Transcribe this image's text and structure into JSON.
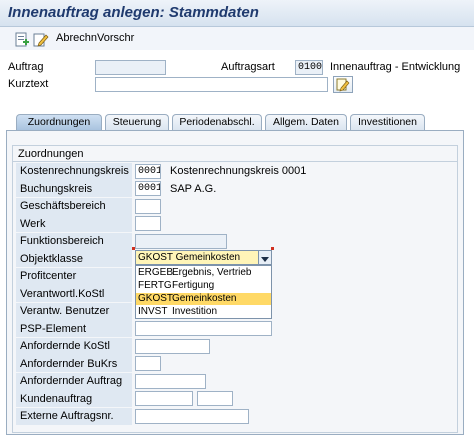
{
  "title": "Innenauftrag anlegen: Stammdaten",
  "toolbar": {
    "text": "AbrechnVorschr",
    "icons": [
      "create-icon",
      "edit-icon"
    ]
  },
  "header": {
    "auftrag_label": "Auftrag",
    "auftrag_value": "",
    "auftragsart_label": "Auftragsart",
    "auftragsart_value": "0100",
    "auftragsart_text": "Innenauftrag - Entwicklung",
    "kurztext_label": "Kurztext",
    "kurztext_value": ""
  },
  "tabs": [
    {
      "label": "Zuordnungen",
      "active": true
    },
    {
      "label": "Steuerung",
      "active": false
    },
    {
      "label": "Periodenabschl.",
      "active": false
    },
    {
      "label": "Allgem. Daten",
      "active": false
    },
    {
      "label": "Investitionen",
      "active": false
    }
  ],
  "group_title": "Zuordnungen",
  "fields": {
    "kostenrechnungskreis": {
      "label": "Kostenrechnungskreis",
      "value": "0001",
      "text": "Kostenrechnungskreis 0001"
    },
    "buchungskreis": {
      "label": "Buchungskreis",
      "value": "0001",
      "text": "SAP A.G."
    },
    "geschaeftsbereich": {
      "label": "Geschäftsbereich",
      "value": ""
    },
    "werk": {
      "label": "Werk",
      "value": ""
    },
    "funktionsbereich": {
      "label": "Funktionsbereich",
      "value": ""
    },
    "objektklasse": {
      "label": "Objektklasse",
      "value": "GKOST Gemeinkosten"
    },
    "profitcenter": {
      "label": "Profitcenter"
    },
    "verantwortl_kostl": {
      "label": "Verantwortl.KoStl"
    },
    "verantw_benutzer": {
      "label": "Verantw. Benutzer"
    },
    "psp_element": {
      "label": "PSP-Element",
      "value": ""
    },
    "anfordernde_kostl": {
      "label": "Anfordernde KoStl",
      "value": ""
    },
    "anfordernder_bukrs": {
      "label": "Anfordernder BuKrs",
      "value": ""
    },
    "anfordernder_auftrag": {
      "label": "Anfordernder Auftrag",
      "value": ""
    },
    "kundenauftrag": {
      "label": "Kundenauftrag",
      "value": "",
      "value2": ""
    },
    "externe_auftragsnr": {
      "label": "Externe Auftragsnr.",
      "value": ""
    }
  },
  "objektklasse_options": [
    {
      "key": "ERGEB",
      "text": "Ergebnis, Vertrieb",
      "selected": false
    },
    {
      "key": "FERTG",
      "text": "Fertigung",
      "selected": false
    },
    {
      "key": "GKOST",
      "text": "Gemeinkosten",
      "selected": true
    },
    {
      "key": "INVST",
      "text": "Investition",
      "selected": false
    }
  ],
  "colors": {
    "title": "#1f3a6e",
    "selected_option": "#ffd966",
    "dropdown_bg": "#fff5b8",
    "field_border": "#9fb2c6"
  }
}
